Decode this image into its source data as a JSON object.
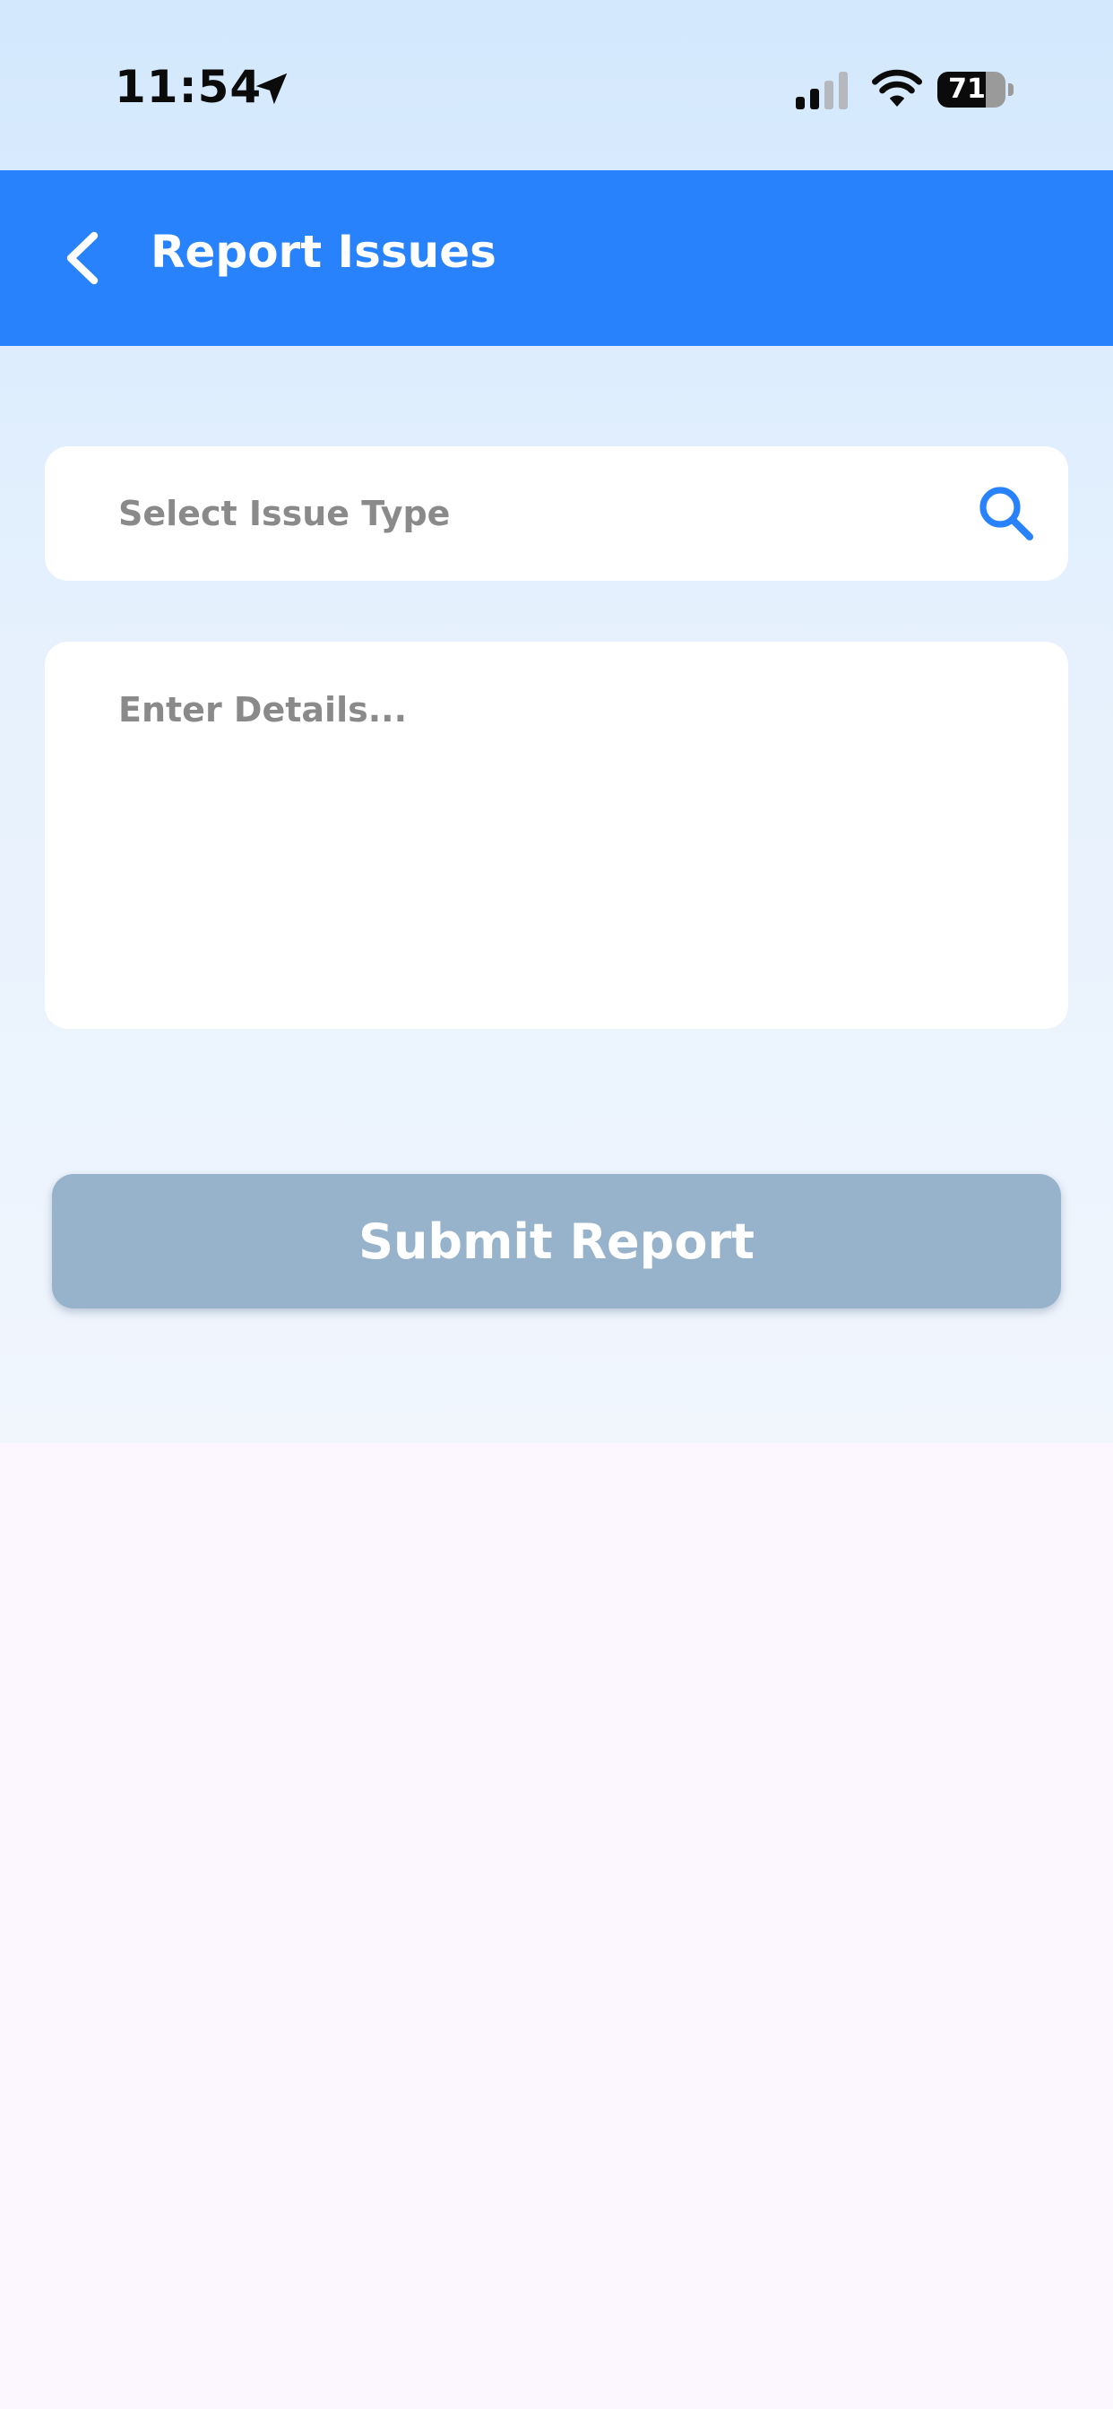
{
  "status_bar": {
    "time": "11:54",
    "battery_level": "71",
    "battery_fraction": 0.71,
    "location_icon": "location-arrow-icon",
    "signal_icon": "cellular-signal-icon",
    "wifi_icon": "wifi-icon"
  },
  "app_bar": {
    "title": "Report Issues",
    "back_icon": "chevron-left-icon",
    "background_color": "#2882fc"
  },
  "form": {
    "issue_type": {
      "value": "",
      "placeholder": "Select Issue Type",
      "icon": "search-icon",
      "icon_color": "#2882fc"
    },
    "details": {
      "value": "",
      "placeholder": "Enter Details..."
    },
    "submit": {
      "label": "Submit Report",
      "color": "#97b3cb"
    }
  }
}
